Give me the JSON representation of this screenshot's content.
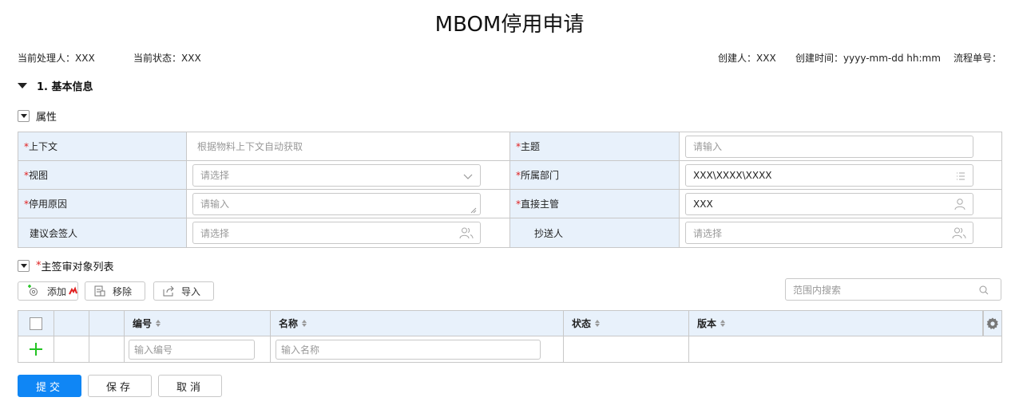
{
  "page": {
    "title": "MBOM停用申请"
  },
  "meta": {
    "handler_label": "当前处理人：",
    "handler_value": "XXX",
    "status_label": "当前状态：",
    "status_value": "XXX",
    "creator_label": "创建人：",
    "creator_value": "XXX",
    "created_label": "创建时间：",
    "created_value": "yyyy-mm-dd hh:mm",
    "flow_label": "流程单号："
  },
  "section1": {
    "title": "1. 基本信息"
  },
  "attrs": {
    "title": "属性",
    "context_label": "上下文",
    "context_value": "根据物料上下文自动获取",
    "subject_label": "主题",
    "subject_placeholder": "请输入",
    "view_label": "视图",
    "view_placeholder": "请选择",
    "dept_label": "所属部门",
    "dept_value": "XXX\\XXXX\\XXXX",
    "reason_label": "停用原因",
    "reason_placeholder": "请输入",
    "manager_label": "直接主管",
    "manager_value": "XXX",
    "cosigner_label": "建议会签人",
    "cosigner_placeholder": "请选择",
    "cc_label": "抄送人",
    "cc_placeholder": "请选择"
  },
  "objects": {
    "title": "主签审对象列表",
    "add": "添加",
    "remove": "移除",
    "import": "导入",
    "search_placeholder": "范围内搜索",
    "columns": [
      "编号",
      "名称",
      "状态",
      "版本"
    ],
    "code_placeholder": "输入编号",
    "name_placeholder": "输入名称"
  },
  "actions": {
    "submit": "提交",
    "save": "保存",
    "cancel": "取消"
  },
  "colors": {
    "primary": "#0f86f5",
    "label_bg": "#e8f1fb",
    "required": "#e02020",
    "add_green": "#22c322"
  }
}
